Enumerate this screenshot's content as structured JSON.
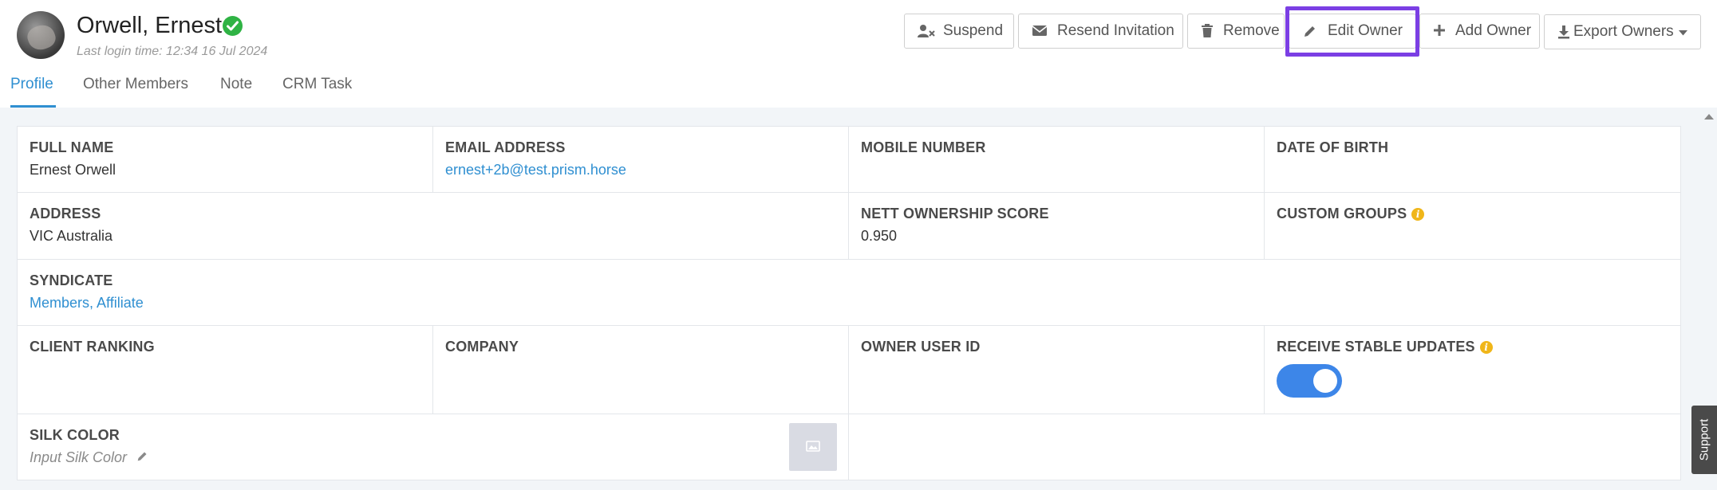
{
  "header": {
    "owner_name": "Orwell, Ernest",
    "last_login": "Last login time: 12:34 16 Jul 2024",
    "verified_icon": "check-circle-icon"
  },
  "tabs": [
    {
      "label": "Profile",
      "active": true
    },
    {
      "label": "Other Members",
      "active": false
    },
    {
      "label": "Note",
      "active": false
    },
    {
      "label": "CRM Task",
      "active": false
    }
  ],
  "actions": {
    "suspend": "Suspend",
    "resend_invitation": "Resend Invitation",
    "remove": "Remove",
    "edit_owner": "Edit Owner",
    "add_owner": "Add Owner",
    "export_owners": "Export Owners"
  },
  "profile": {
    "full_name": {
      "label": "FULL NAME",
      "value": "Ernest Orwell"
    },
    "email": {
      "label": "EMAIL ADDRESS",
      "value": "ernest+2b@test.prism.horse"
    },
    "mobile": {
      "label": "MOBILE NUMBER",
      "value": ""
    },
    "dob": {
      "label": "DATE OF BIRTH",
      "value": ""
    },
    "address": {
      "label": "ADDRESS",
      "value": "VIC Australia"
    },
    "nett_ownership": {
      "label": "NETT OWNERSHIP SCORE",
      "value": "0.950"
    },
    "custom_groups": {
      "label": "CUSTOM GROUPS",
      "value": ""
    },
    "syndicate": {
      "label": "SYNDICATE",
      "value": "Members, Affiliate"
    },
    "client_ranking": {
      "label": "CLIENT RANKING",
      "value": ""
    },
    "company": {
      "label": "COMPANY",
      "value": ""
    },
    "owner_user_id": {
      "label": "OWNER USER ID",
      "value": ""
    },
    "receive_stable_updates": {
      "label": "RECEIVE STABLE UPDATES",
      "enabled": true
    },
    "silk_color": {
      "label": "SILK COLOR",
      "placeholder": "Input Silk Color"
    }
  },
  "support": {
    "label": "Support"
  },
  "colors": {
    "accent": "#2f8fd1",
    "highlight": "#7b3fe4",
    "toggle": "#3d86e8",
    "verified": "#2fb344",
    "info": "#f0b619"
  }
}
